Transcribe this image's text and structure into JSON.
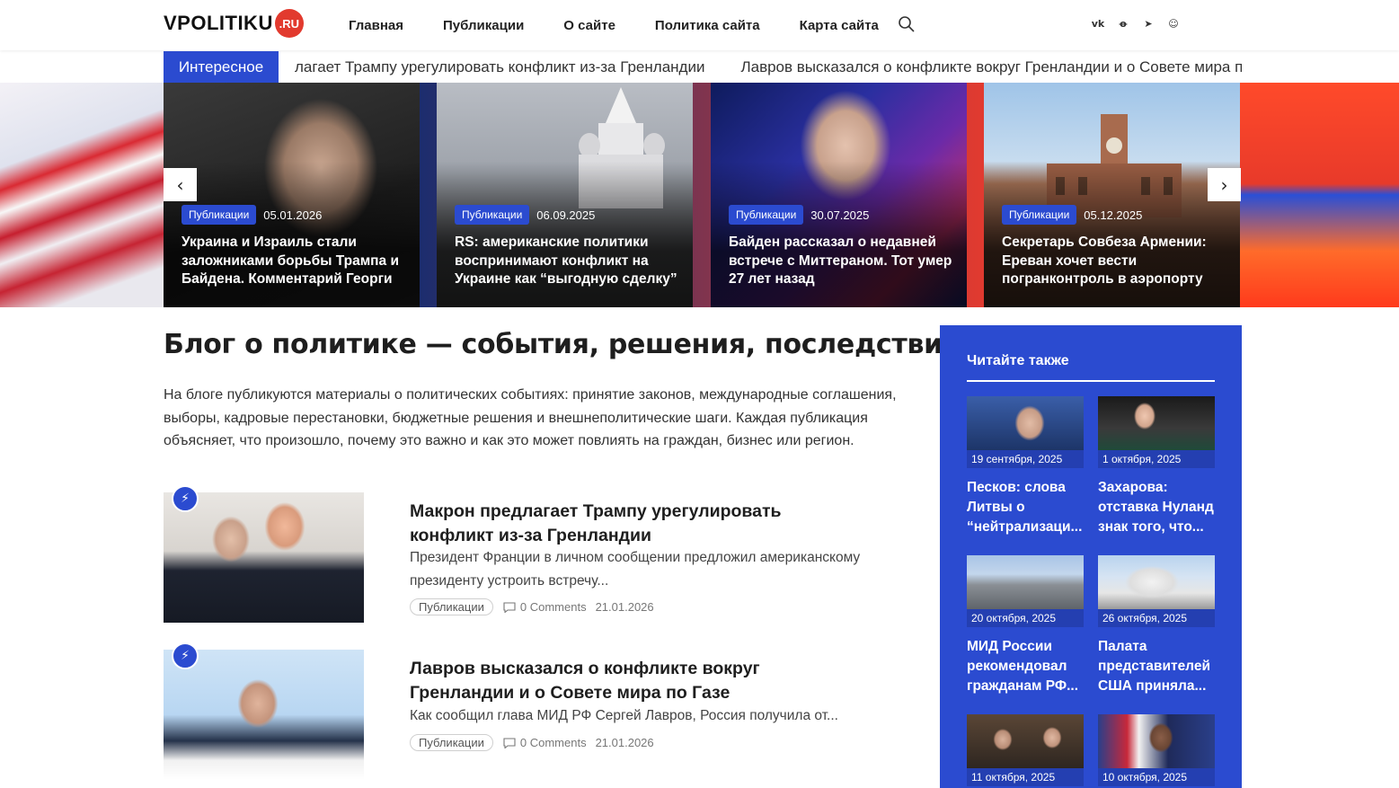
{
  "header": {
    "logo_text": "VPOLITIKU",
    "logo_badge": ".RU",
    "nav": [
      "Главная",
      "Публикации",
      "О сайте",
      "Политика сайта",
      "Карта сайта"
    ],
    "socials": [
      "vk-icon",
      "ok-icon",
      "telegram-icon",
      "dzen-icon"
    ]
  },
  "ticker": {
    "label": "Интересное",
    "items": [
      "лагает Трампу урегулировать конфликт из-за Гренландии",
      "Лавров высказался о конфликте вокруг Гренландии и о Совете мира по Газе"
    ]
  },
  "slider": {
    "prev": "‹",
    "next": "›",
    "slides": [
      {
        "category": "Публикации",
        "date": "05.01.2026",
        "title": "Украина и Израиль стали заложниками борьбы Трампа и Байдена. Комментарий Георги"
      },
      {
        "category": "Публикации",
        "date": "06.09.2025",
        "title": "RS: американские политики воспринимают конфликт на Украине как “выгодную сделку”"
      },
      {
        "category": "Публикации",
        "date": "30.07.2025",
        "title": "Байден рассказал о недавней встрече с Миттераном. Тот умер 27 лет назад"
      },
      {
        "category": "Публикации",
        "date": "05.12.2025",
        "title": "Секретарь Совбеза Армении: Ереван хочет вести погранконтроль в аэропорту"
      }
    ]
  },
  "main": {
    "title": "Блог о политике — события, решения, последствия",
    "description": "На блоге публикуются материалы о политических событиях: принятие законов, международные соглашения, выборы, кадровые перестановки, бюджетные решения и внешнеполитические шаги. Каждая публикация объясняет, что произошло, почему это важно и как это может повлиять на граждан, бизнес или регион.",
    "posts": [
      {
        "title": "Макрон предлагает Трампу урегулировать конфликт из-за Гренландии",
        "excerpt": "Президент Франции в личном сообщении предложил американскому президенту устроить встречу...",
        "category": "Публикации",
        "comments": "0 Comments",
        "date": "21.01.2026"
      },
      {
        "title": "Лавров высказался о конфликте вокруг Гренландии и о Совете мира по Газе",
        "excerpt": "Как сообщил глава МИД РФ Сергей Лавров, Россия получила от...",
        "category": "Публикации",
        "comments": "0 Comments",
        "date": "21.01.2026"
      }
    ]
  },
  "sidebar": {
    "title": "Читайте также",
    "cards": [
      {
        "date": "19 сентября, 2025",
        "title": "Песков: слова Литвы о “нейтрализаци..."
      },
      {
        "date": "1 октября, 2025",
        "title": "Захарова: отставка Нуланд знак того, что..."
      },
      {
        "date": "20 октября, 2025",
        "title": "МИД России рекомендовал гражданам РФ..."
      },
      {
        "date": "26 октября, 2025",
        "title": "Палата представителей США приняла..."
      },
      {
        "date": "11 октября, 2025",
        "title": ""
      },
      {
        "date": "10 октября, 2025",
        "title": ""
      }
    ]
  },
  "colors": {
    "accent": "#2b4bd0",
    "logo_badge": "#e23a2e"
  }
}
